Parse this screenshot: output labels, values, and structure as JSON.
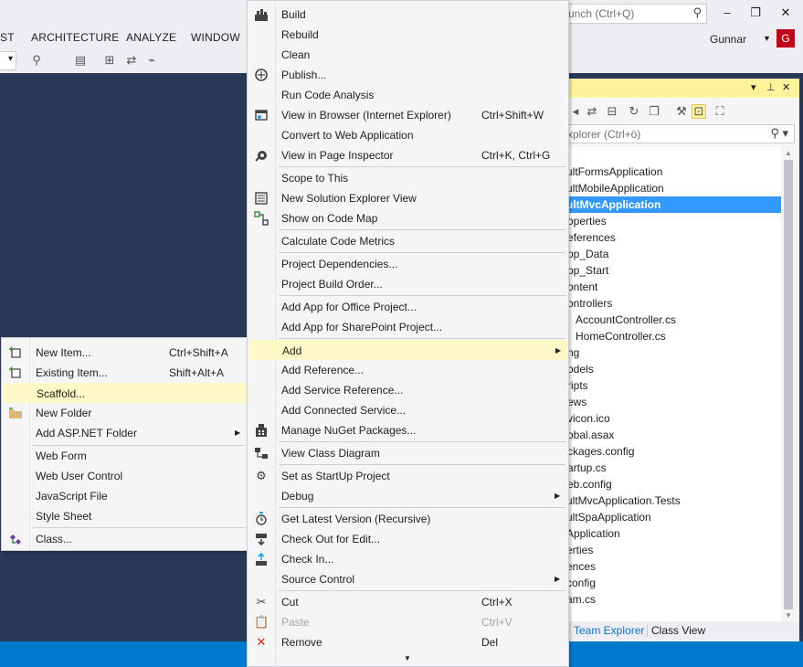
{
  "menubar": {
    "items": [
      "ST",
      "ARCHITECTURE",
      "ANALYZE",
      "WINDOW"
    ]
  },
  "quick_launch": {
    "placeholder": "unch (Ctrl+Q)"
  },
  "window": {
    "minimize": "–",
    "maximize": "❐",
    "close": "✕"
  },
  "user": {
    "name": "Gunnar",
    "initial": "G"
  },
  "solution_explorer": {
    "search_placeholder": "xplorer (Ctrl+ö)",
    "tree": [
      "ultFormsApplication",
      "ultMobileApplication",
      "ultMvcApplication",
      "operties",
      "eferences",
      "pp_Data",
      "pp_Start",
      "ontent",
      "ontrollers",
      "AccountController.cs",
      "HomeController.cs",
      "ng",
      "odels",
      "ripts",
      "ews",
      "vicon.ico",
      "obal.asax",
      "ckages.config",
      "artup.cs",
      "eb.config",
      "ultMvcApplication.Tests",
      "ultSpaApplication",
      "Application",
      "erties",
      "ences",
      "config",
      "am.cs"
    ],
    "tabs": [
      "Team Explorer",
      "Class View"
    ]
  },
  "context_menu": {
    "items": [
      {
        "label": "Build",
        "icon": "build-icon"
      },
      {
        "label": "Rebuild"
      },
      {
        "label": "Clean"
      },
      {
        "label": "Publish...",
        "icon": "publish-icon"
      },
      {
        "label": "Run Code Analysis"
      },
      {
        "label": "View in Browser (Internet Explorer)",
        "shortcut": "Ctrl+Shift+W",
        "icon": "browser-icon"
      },
      {
        "label": "Convert to Web Application"
      },
      {
        "label": "View in Page Inspector",
        "shortcut": "Ctrl+K, Ctrl+G",
        "icon": "page-inspector-icon"
      },
      {
        "label": "Scope to This"
      },
      {
        "label": "New Solution Explorer View",
        "icon": "new-view-icon"
      },
      {
        "label": "Show on Code Map",
        "icon": "code-map-icon"
      },
      {
        "label": "Calculate Code Metrics"
      },
      {
        "label": "Project Dependencies..."
      },
      {
        "label": "Project Build Order..."
      },
      {
        "label": "Add App for Office Project..."
      },
      {
        "label": "Add App for SharePoint Project..."
      },
      {
        "label": "Add"
      },
      {
        "label": "Add Reference..."
      },
      {
        "label": "Add Service Reference..."
      },
      {
        "label": "Add Connected Service..."
      },
      {
        "label": "Manage NuGet Packages...",
        "icon": "nuget-icon"
      },
      {
        "label": "View Class Diagram",
        "icon": "class-diagram-icon"
      },
      {
        "label": "Set as StartUp Project",
        "icon": "gear-icon"
      },
      {
        "label": "Debug"
      },
      {
        "label": "Get Latest Version (Recursive)",
        "icon": "get-latest-icon"
      },
      {
        "label": "Check Out for Edit...",
        "icon": "check-out-icon"
      },
      {
        "label": "Check In...",
        "icon": "check-in-icon"
      },
      {
        "label": "Source Control"
      },
      {
        "label": "Cut",
        "shortcut": "Ctrl+X",
        "icon": "scissors-icon"
      },
      {
        "label": "Paste",
        "shortcut": "Ctrl+V",
        "icon": "paste-icon"
      },
      {
        "label": "Remove",
        "shortcut": "Del",
        "icon": "remove-icon"
      }
    ]
  },
  "add_submenu": {
    "items": [
      {
        "label": "New Item...",
        "shortcut": "Ctrl+Shift+A",
        "icon": "new-item-icon"
      },
      {
        "label": "Existing Item...",
        "shortcut": "Shift+Alt+A",
        "icon": "existing-item-icon"
      },
      {
        "label": "Scaffold..."
      },
      {
        "label": "New Folder",
        "icon": "folder-icon"
      },
      {
        "label": "Add ASP.NET Folder"
      },
      {
        "label": "Web Form"
      },
      {
        "label": "Web User Control"
      },
      {
        "label": "JavaScript File"
      },
      {
        "label": "Style Sheet"
      },
      {
        "label": "Class...",
        "icon": "class-icon"
      }
    ]
  },
  "colors": {
    "highlight": "#fef9c6",
    "selection": "#3399ff",
    "status_bar": "#007acc",
    "editor_background": "#293955"
  }
}
